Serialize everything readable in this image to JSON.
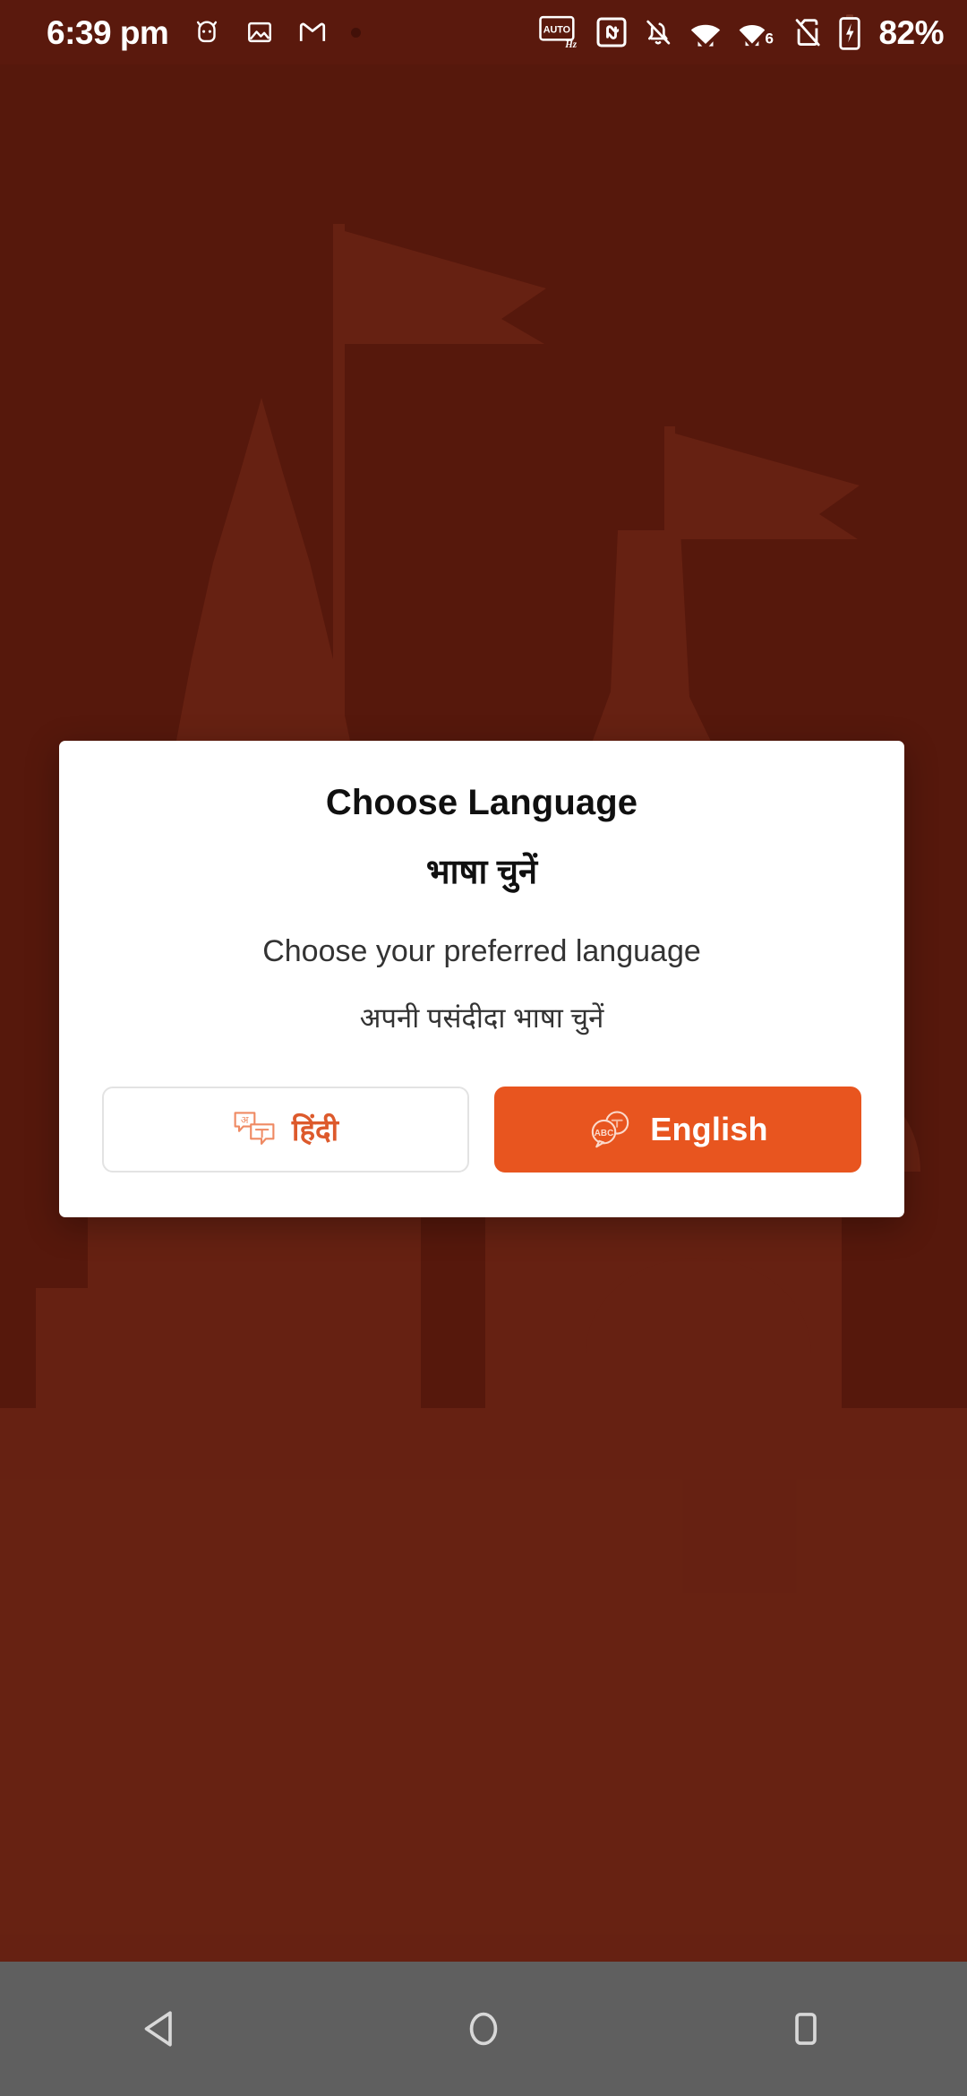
{
  "theme": {
    "background": "#5a190d",
    "accent": "#e8551f",
    "accent_muted": "#dd5a2c",
    "dialog_background": "#ffffff",
    "navbar_background": "#5f5f5f",
    "status_text": "#ffffff"
  },
  "statusbar": {
    "clock": "6:39 pm",
    "battery_percent": "82%",
    "left_icons": [
      {
        "name": "bot-face-icon"
      },
      {
        "name": "photos-image-icon"
      },
      {
        "name": "gmail-icon"
      },
      {
        "name": "notification-dot-icon"
      }
    ],
    "right_icons": [
      {
        "name": "auto-hz-refresh-rate-icon",
        "label": "AUTO",
        "sublabel": "Hz"
      },
      {
        "name": "nfc-icon"
      },
      {
        "name": "notifications-silenced-bell-icon"
      },
      {
        "name": "wifi-icon"
      },
      {
        "name": "wifi-6-icon",
        "label": "6"
      },
      {
        "name": "no-sim-card-icon"
      },
      {
        "name": "battery-charging-icon"
      }
    ]
  },
  "dialog": {
    "title": "Choose Language",
    "title_hindi": "भाषा चुनें",
    "subtitle": "Choose your preferred language",
    "subtitle_hindi": "अपनी पसंदीदा भाषा चुनें",
    "buttons": [
      {
        "key": "hindi",
        "label": "हिंदी",
        "icon": "translate-speech-bubbles-devanagari-icon",
        "style": "outline",
        "selected": false
      },
      {
        "key": "english",
        "label": "English",
        "icon": "translate-speech-bubbles-abc-icon",
        "icon_text": "ABC",
        "style": "filled",
        "selected": true
      }
    ]
  },
  "navbar": {
    "buttons": [
      {
        "name": "back-button",
        "icon": "triangle-back-icon"
      },
      {
        "name": "home-button",
        "icon": "circle-home-icon"
      },
      {
        "name": "recents-button",
        "icon": "square-recents-icon"
      }
    ]
  },
  "background_art": {
    "name": "temple-silhouette-watermark",
    "description": "faint temple shikhara with flags, dome and chhatri umbrellas"
  }
}
